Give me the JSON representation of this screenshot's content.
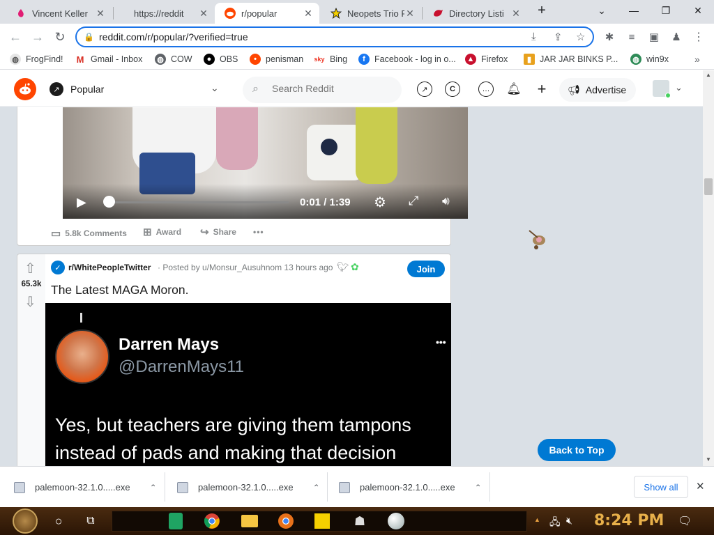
{
  "browser": {
    "tabs": [
      {
        "title": "Vincent Keller",
        "favicon": "pink-favicon"
      },
      {
        "title": "https://reddit",
        "favicon": "blank-favicon"
      },
      {
        "title": "r/popular",
        "favicon": "reddit-favicon"
      },
      {
        "title": "Neopets Trio F",
        "favicon": "star-favicon"
      },
      {
        "title": "Directory Listi",
        "favicon": "red-bird-favicon"
      }
    ],
    "url": "reddit.com/r/popular/?verified=true",
    "bookmarks": [
      "FrogFind!",
      "Gmail - Inbox",
      "COW",
      "OBS",
      "penisman",
      "Bing",
      "Facebook - log in o...",
      "Firefox",
      "JAR JAR BINKS P...",
      "win9x"
    ]
  },
  "reddit": {
    "feed_label": "Popular",
    "search_placeholder": "Search Reddit",
    "advertise_label": "Advertise",
    "video": {
      "time": "0:01 / 1:39",
      "comments": "5.8k Comments",
      "award": "Award",
      "share": "Share",
      "more": "•••"
    },
    "post": {
      "subreddit": "r/WhitePeopleTwitter",
      "meta": "· Posted by u/Monsur_Ausuhnom 13 hours ago",
      "join": "Join",
      "votes": "65.3k",
      "title": "The Latest MAGA Moron.",
      "tweet_name": "Darren Mays",
      "tweet_handle": "@DarrenMays11",
      "tweet_text_1": "Yes, but teachers are giving them tampons",
      "tweet_text_2": "instead of pads and making that decision",
      "tweet_more": "•••"
    },
    "back_to_top": "Back to Top"
  },
  "downloads": {
    "items": [
      "palemoon-32.1.0.....exe",
      "palemoon-32.1.0.....exe",
      "palemoon-32.1.0.....exe"
    ],
    "show_all": "Show all"
  },
  "taskbar": {
    "clock": "8:24 PM"
  },
  "colors": {
    "reddit_orange": "#ff4500",
    "reddit_blue": "#0079d3",
    "feed_bg": "#dae0e6"
  }
}
